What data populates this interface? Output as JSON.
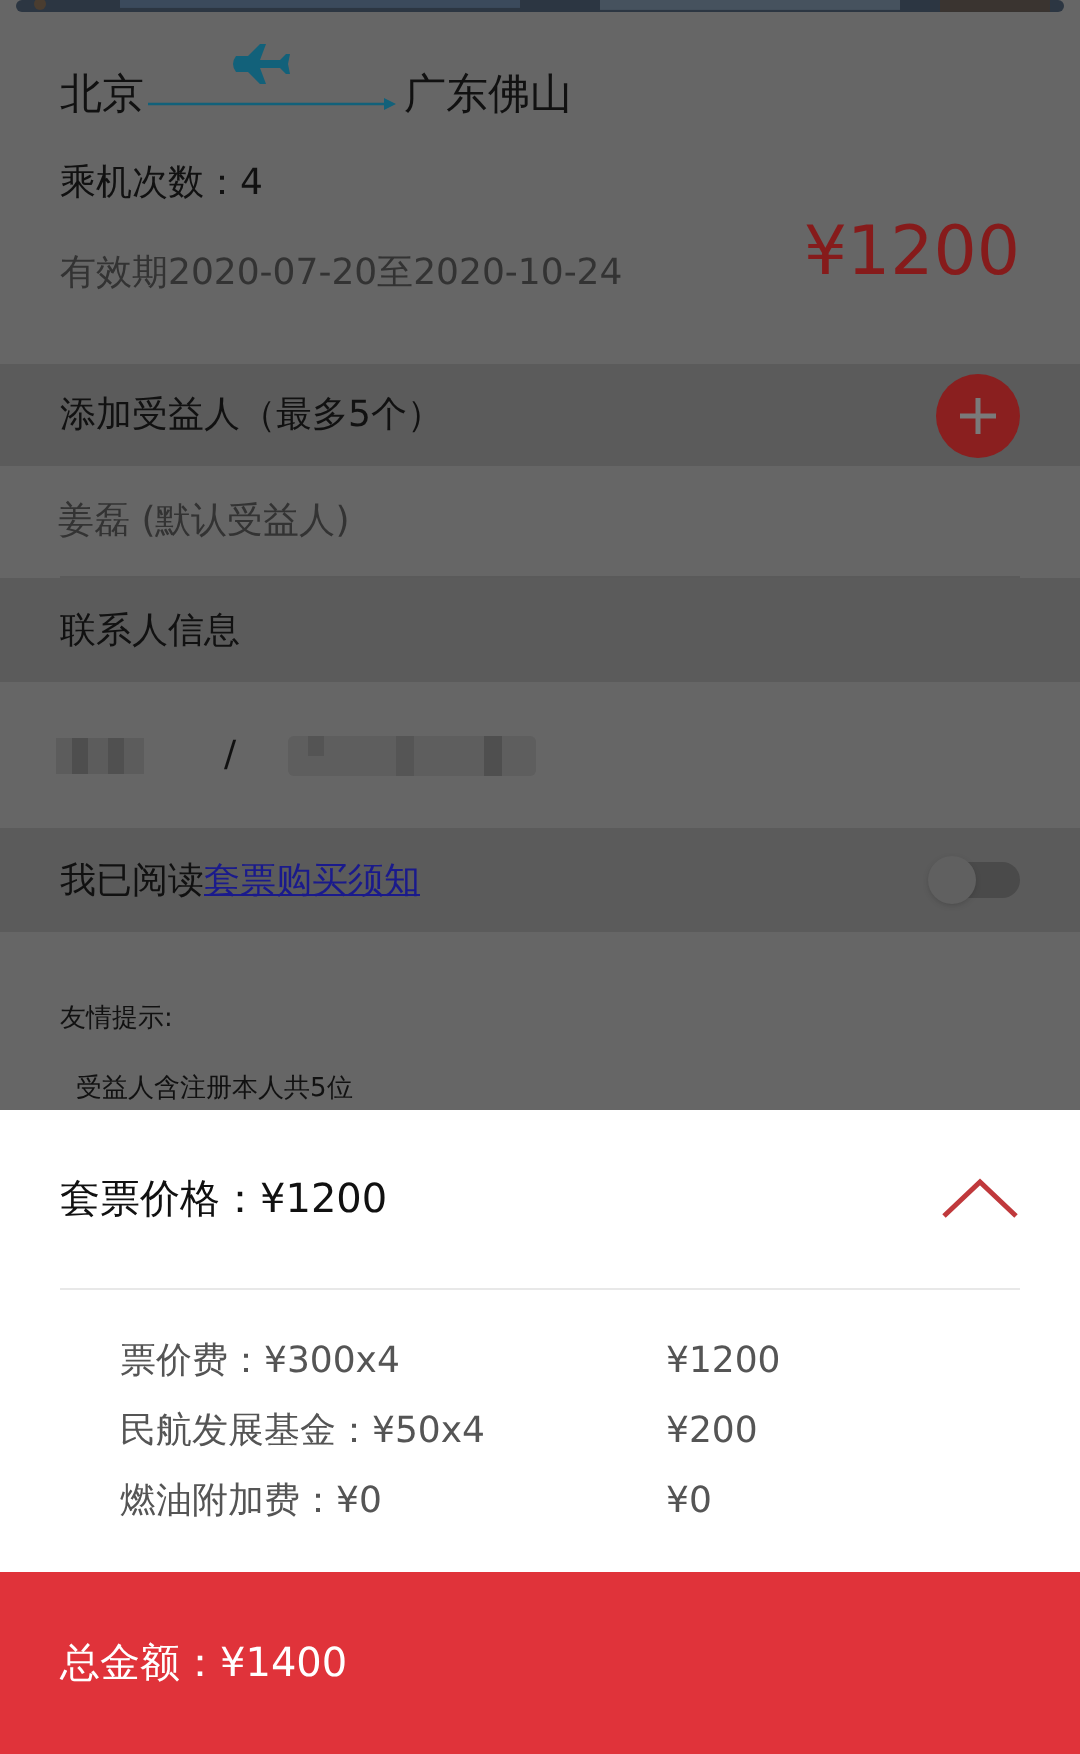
{
  "route": {
    "from": "北京",
    "to": "广东佛山"
  },
  "flights": "乘机次数：4",
  "validity": "有效期2020-07-20至2020-10-24",
  "price": "¥1200",
  "beneficiaries": {
    "title": "添加受益人（最多5个）",
    "items": [
      "姜磊 (默认受益人)"
    ]
  },
  "contact": {
    "title": "联系人信息",
    "separator": "/"
  },
  "agreement": {
    "prefix": "我已阅读",
    "link": "套票购买须知",
    "checked": false
  },
  "tips": {
    "title": "友情提示:",
    "items": [
      "受益人含注册本人共5位"
    ]
  },
  "price_sheet": {
    "title": "套票价格：¥1200",
    "expanded": true,
    "rows": [
      {
        "label": "票价费：¥300x4",
        "amount": "¥1200"
      },
      {
        "label": "民航发展基金：¥50x4",
        "amount": "¥200"
      },
      {
        "label": "燃油附加费：¥0",
        "amount": "¥0"
      }
    ]
  },
  "total": "总金额：¥1400"
}
